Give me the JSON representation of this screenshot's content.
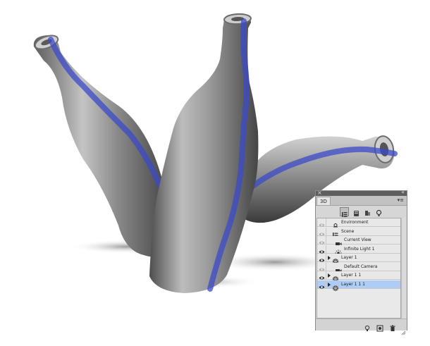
{
  "panel": {
    "close_glyph": "×",
    "collapse_glyph": "«",
    "tab_label": "3D",
    "menu_glyph": "▾≡",
    "toolbar": [
      {
        "icon": "scene-filter-icon",
        "active": true
      },
      {
        "icon": "mesh-filter-icon",
        "active": false
      },
      {
        "icon": "material-filter-icon",
        "active": false
      },
      {
        "icon": "light-filter-icon",
        "active": false
      }
    ],
    "layers": [
      {
        "label": "Environment",
        "icon": "environment-icon",
        "visible": false,
        "expandable": false,
        "indent": 0,
        "selected": false
      },
      {
        "label": "Scene",
        "icon": "scene-icon",
        "visible": false,
        "expandable": false,
        "indent": 0,
        "selected": false
      },
      {
        "label": "Current View",
        "icon": "camera-icon",
        "visible": false,
        "expandable": false,
        "indent": 1,
        "selected": false
      },
      {
        "label": "Infinite Light 1",
        "icon": "infinite-light-icon",
        "visible": true,
        "expandable": false,
        "indent": 1,
        "selected": false
      },
      {
        "label": "Layer 1",
        "icon": "mesh-icon",
        "visible": true,
        "expandable": true,
        "indent": 0,
        "selected": false
      },
      {
        "label": "Default Camera",
        "icon": "camera-icon",
        "visible": false,
        "expandable": false,
        "indent": 1,
        "selected": false
      },
      {
        "label": "Layer 1 1",
        "icon": "mesh-icon",
        "visible": true,
        "expandable": true,
        "indent": 0,
        "selected": false
      },
      {
        "label": "Layer 1 1 1",
        "icon": "mesh-icon",
        "visible": true,
        "expandable": true,
        "indent": 0,
        "selected": true
      }
    ],
    "bottom_buttons": [
      "add-light-icon",
      "render-icon",
      "delete-icon"
    ]
  },
  "colors": {
    "bottle_stripe": "#3b49c8",
    "bottle_body": "#8c8c8c",
    "selection": "#aecdf6",
    "panel_bg": "#d6d6d6"
  }
}
